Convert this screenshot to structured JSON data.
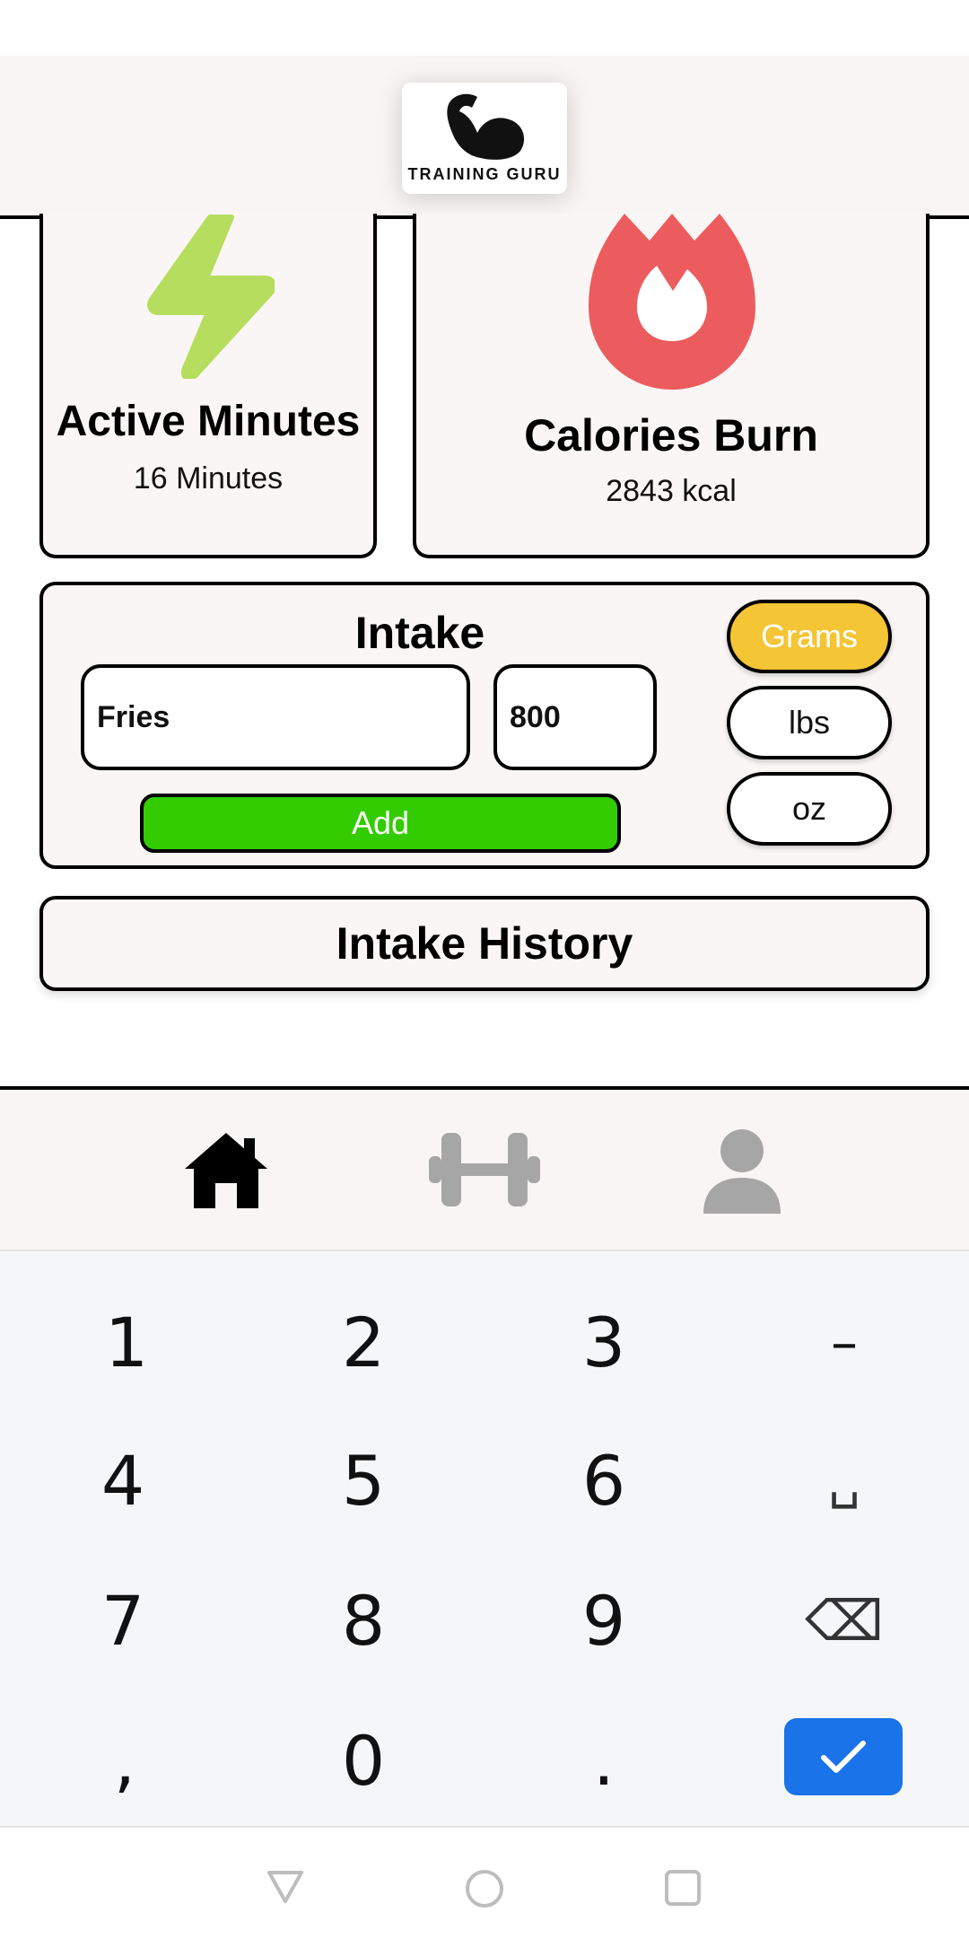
{
  "app": {
    "logo_text": "TRAINING GURU"
  },
  "stats": {
    "active": {
      "title": "Active Minutes",
      "value": "16 Minutes",
      "icon": "lightning-icon",
      "color": "#b6dd5e"
    },
    "calories": {
      "title": "Calories Burn",
      "value": "2843 kcal",
      "icon": "flame-icon",
      "color": "#ec5c5e"
    }
  },
  "intake": {
    "title": "Intake",
    "food_value": "Fries",
    "quantity_value": "800",
    "add_label": "Add",
    "units": [
      {
        "label": "Grams",
        "selected": true
      },
      {
        "label": "lbs",
        "selected": false
      },
      {
        "label": "oz",
        "selected": false
      }
    ],
    "accent": "#f4c534",
    "add_color": "#33cc00"
  },
  "history": {
    "label": "Intake History"
  },
  "nav": [
    {
      "icon": "home-icon",
      "active": true
    },
    {
      "icon": "dumbbell-icon",
      "active": false
    },
    {
      "icon": "profile-icon",
      "active": false
    }
  ],
  "keyboard": {
    "keys": [
      "1",
      "2",
      "3",
      "–",
      "4",
      "5",
      "6",
      "␣",
      "7",
      "8",
      "9",
      "⌫",
      ",",
      "0",
      ".",
      "✓"
    ],
    "done_color": "#1a73e8"
  }
}
